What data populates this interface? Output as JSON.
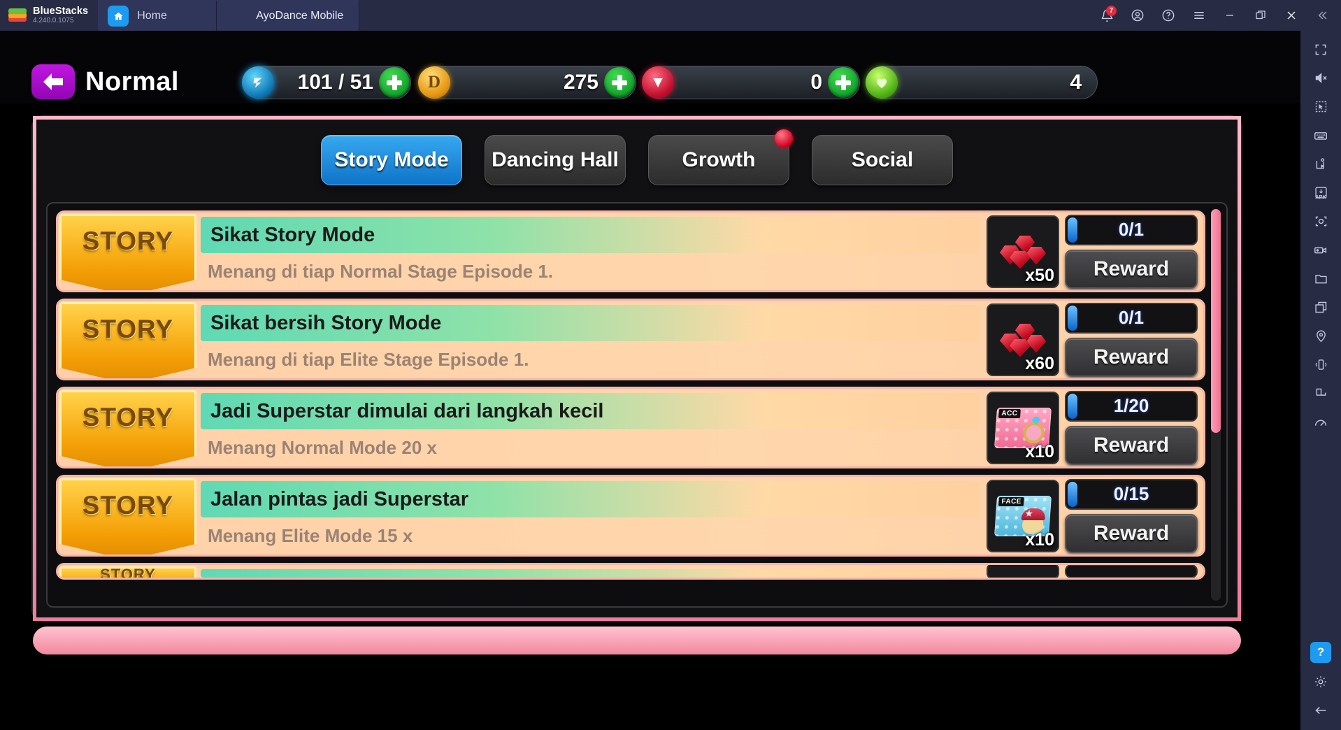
{
  "titlebar": {
    "brand": "BlueStacks",
    "version": "4.240.0.1075",
    "tabs": [
      {
        "label": "Home",
        "icon": "home-icon"
      },
      {
        "label": "AyoDance Mobile",
        "icon": "game-thumbnail"
      }
    ],
    "controls": [
      {
        "name": "notifications-icon",
        "badge": "7"
      },
      {
        "name": "account-icon"
      },
      {
        "name": "help-icon"
      },
      {
        "name": "menu-icon"
      },
      {
        "name": "minimize-icon"
      },
      {
        "name": "maximize-icon"
      },
      {
        "name": "close-icon"
      },
      {
        "name": "collapse-sidebar-icon"
      }
    ]
  },
  "sidebar": {
    "items": [
      "fullscreen-icon",
      "mute-icon",
      "pointer-select-icon",
      "keyboard-controls-icon",
      "macro-recorder-icon",
      "install-apk-icon",
      "screenshot-icon",
      "record-video-icon",
      "media-folder-icon",
      "multi-instance-icon",
      "location-icon",
      "shake-icon",
      "rotate-icon",
      "performance-icon"
    ],
    "bottom": [
      "help-icon",
      "settings-icon",
      "back-icon"
    ]
  },
  "game": {
    "header": {
      "back_label": "back-arrow",
      "title": "Normal",
      "counters": [
        {
          "name": "mission-counter",
          "icon": "mission-icon",
          "value": "101 / 51",
          "plus": true
        },
        {
          "name": "gold-counter",
          "icon": "gold-coin-icon",
          "value": "275",
          "plus": true
        },
        {
          "name": "diamond-counter",
          "icon": "diamond-icon",
          "value": "0",
          "plus": true
        },
        {
          "name": "heart-counter",
          "icon": "heart-icon",
          "value": "4",
          "plus": false
        }
      ]
    },
    "tabs": [
      {
        "label": "Story Mode",
        "active": true,
        "dot": false
      },
      {
        "label": "Dancing Hall",
        "active": false,
        "dot": false
      },
      {
        "label": "Growth",
        "active": false,
        "dot": true
      },
      {
        "label": "Social",
        "active": false,
        "dot": false
      }
    ],
    "quests": [
      {
        "badge": "STORY",
        "title": "Sikat Story Mode",
        "desc": "Menang di tiap Normal Stage Episode 1.",
        "reward_icon": "ruby-gems-icon",
        "reward_qty": "x50",
        "progress": "0/1",
        "button": "Reward"
      },
      {
        "badge": "STORY",
        "title": "Sikat bersih Story Mode",
        "desc": "Menang di tiap Elite Stage Episode 1.",
        "reward_icon": "ruby-gems-icon",
        "reward_qty": "x60",
        "progress": "0/1",
        "button": "Reward"
      },
      {
        "badge": "STORY",
        "title": "Jadi Superstar dimulai dari langkah kecil",
        "desc": "Menang Normal Mode 20 x",
        "reward_icon": "acc-card-icon",
        "reward_qty": "x10",
        "progress": "1/20",
        "button": "Reward"
      },
      {
        "badge": "STORY",
        "title": "Jalan pintas jadi Superstar",
        "desc": "Menang Elite Mode 15 x",
        "reward_icon": "face-card-icon",
        "reward_qty": "x10",
        "progress": "0/15",
        "button": "Reward"
      },
      {
        "badge": "STORY",
        "title": "",
        "desc": "",
        "reward_icon": "",
        "reward_qty": "",
        "progress": "",
        "button": ""
      }
    ]
  },
  "colors": {
    "accent_blue": "#1d9bf0",
    "panel_pink": "#ffb8c8",
    "row_peach": "#ffd0a8",
    "badge_gold": "#f5a006",
    "title_purple": "#c017e0",
    "alert_red": "#d4001f"
  }
}
